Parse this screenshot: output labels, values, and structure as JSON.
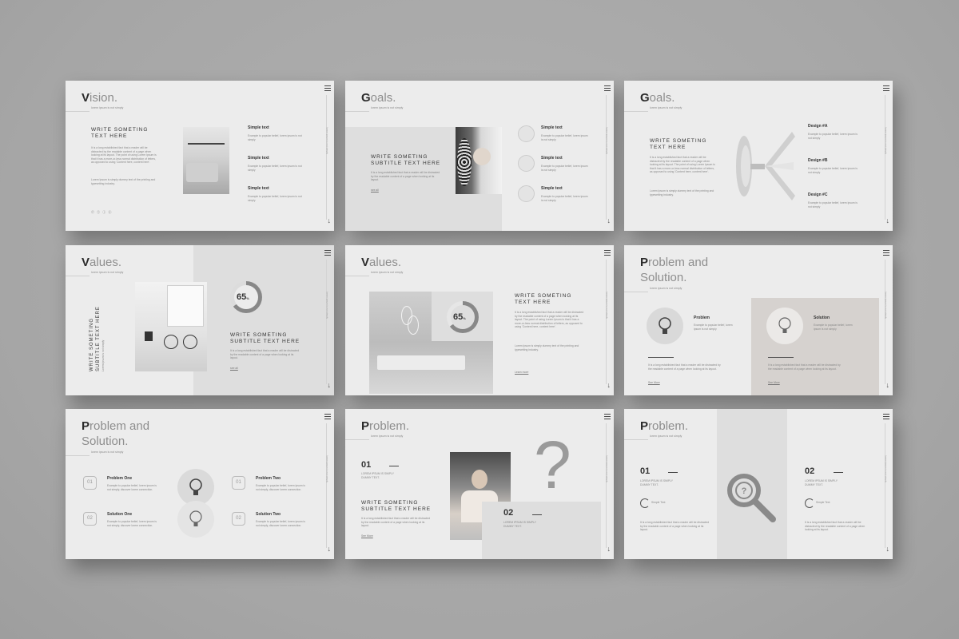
{
  "colors": {
    "background": "#a9a9a9",
    "slide": "#ececec",
    "accent": "#2b2b2b",
    "panel": "#dedede"
  },
  "common": {
    "subtitle": "lorem ipsum is not simply",
    "menu_icon": "hamburger-icon",
    "arrow_icon": "arrow-down-icon",
    "arrow_glyph": "↓",
    "vertical_text": "lorem ipsum is not simply"
  },
  "slides": [
    {
      "title_initial": "V",
      "title_rest": "ision.",
      "heading": "WRITE SOMETING\nTEXT HERE",
      "body1": "It is a long established fact that a reader will be distracted by the readable content of a page when looking at its layout. The point of using Lorem Ipsum is that it has a more-or-less normal distribution of letters, as opposed to using 'Content here, content here'.",
      "body2": "Lorem Ipsum is simply dummy text of the printing and typesetting industry.",
      "social": "ⓕ ⓣ ⓘ ⓨ",
      "items": [
        {
          "t": "Simple text",
          "d": "Example to popular belief, lorem ipsum is not simply"
        },
        {
          "t": "Simple text",
          "d": "Example to popular belief, lorem ipsum is not simply"
        },
        {
          "t": "Simple text",
          "d": "Example to popular belief, lorem ipsum is not simply"
        }
      ]
    },
    {
      "title_initial": "G",
      "title_rest": "oals.",
      "heading": "WRITE SOMETING\nSUBTITLE TEXT HERE",
      "body1": "It is a long established fact that a reader will be distracted by the readable content of a page when looking at its layout.",
      "link": "see all",
      "items": [
        {
          "t": "Simple text",
          "d": "Example to popular belief, lorem ipsum is not simply"
        },
        {
          "t": "Simple text",
          "d": "Example to popular belief, lorem ipsum is not simply"
        },
        {
          "t": "Simple text",
          "d": "Example to popular belief, lorem ipsum is not simply"
        }
      ]
    },
    {
      "title_initial": "G",
      "title_rest": "oals.",
      "heading": "WRITE SOMETING\nTEXT HERE",
      "body1": "It is a long established fact that a reader will be distracted by the readable content of a page when looking at its layout. The point of using Lorem Ipsum is that it has a more-or-less normal distribution of letters, as opposed to using 'Content here, content here'.",
      "body2": "Lorem Ipsum is simply dummy text of the printing and typesetting industry.",
      "items": [
        {
          "t": "Design #A",
          "d": "Example to popular belief, lorem ipsum is not simply"
        },
        {
          "t": "Design #B",
          "d": "Example to popular belief, lorem ipsum is not simply"
        },
        {
          "t": "Design #C",
          "d": "Example to popular belief, lorem ipsum is not simply"
        }
      ]
    },
    {
      "title_initial": "V",
      "title_rest": "alues.",
      "vheading": "WRITE SOMETING\nSUBTITLE TEXT HERE",
      "vsmall": "Lorem ipsum is not simply",
      "percent": "65",
      "percent_sign": "%",
      "heading": "WRITE SOMETING\nSUBTITLE TEXT HERE",
      "body1": "It is a long established fact that a reader will be distracted by the readable content of a page when looking at its layout.",
      "link": "see all"
    },
    {
      "title_initial": "V",
      "title_rest": "alues.",
      "percent": "65",
      "percent_sign": "%",
      "heading": "WRITE SOMETING\nTEXT HERE",
      "body1": "It is a long established fact that a reader will be distracted by the readable content of a page when looking at its layout. The point of using Lorem Ipsum is that it has a more-or-less normal distribution of letters, as opposed to using 'Content here, content here'.",
      "body2": "Lorem Ipsum is simply dummy text of the printing and typesetting industry.",
      "link": "Learn more"
    },
    {
      "title_initial": "P",
      "title_rest": "roblem and\nSolution.",
      "items": [
        {
          "t": "Problem",
          "d": "Example to popular belief, lorem ipsum is not simply"
        },
        {
          "t": "Solution",
          "d": "Example to popular belief, lorem ipsum is not simply"
        }
      ],
      "body_left": "It is a long established fact that a reader will be distracted by the readable content of a page when looking at its layout.",
      "body_right": "It is a long established fact that a reader will be distracted by the readable content of a page when looking at its layout.",
      "link": "See More"
    },
    {
      "title_initial": "P",
      "title_rest": "roblem and\nSolution.",
      "items": [
        {
          "n": "01",
          "t": "Problem One",
          "d": "Example to popular belief, lorem ipsum is not simply, discover lorem connection."
        },
        {
          "n": "02",
          "t": "Solution One",
          "d": "Example to popular belief, lorem ipsum is not simply, discover lorem connection."
        },
        {
          "n": "01",
          "t": "Problem Two",
          "d": "Example to popular belief, lorem ipsum is not simply, discover lorem connection."
        },
        {
          "n": "02",
          "t": "Solution Two",
          "d": "Example to popular belief, lorem ipsum is not simply, discover lorem connection."
        }
      ]
    },
    {
      "title_initial": "P",
      "title_rest": "roblem.",
      "n1": "01",
      "cap1": "LOREM IPSUM IS SIMPLY\nDUMMY TEXT.",
      "n2": "02",
      "cap2": "LOREM IPSUM IS SIMPLY\nDUMMY TEXT.",
      "heading": "WRITE SOMETING\nSUBTITLE TEXT HERE",
      "body1": "It is a long established fact that a reader will be distracted by the readable content of a page when looking at its layout.",
      "link": "See More",
      "qmark": "?"
    },
    {
      "title_initial": "P",
      "title_rest": "roblem.",
      "n1": "01",
      "cap1": "LOREM IPSUM IS SIMPLY\nDUMMY TEXT.",
      "n2": "02",
      "cap2": "LOREM IPSUM IS SIMPLY\nDUMMY TEXT.",
      "sample": "Simple Text",
      "body1": "It is a long established fact that a reader will be distracted by the readable content of a page when looking at its layout."
    }
  ]
}
